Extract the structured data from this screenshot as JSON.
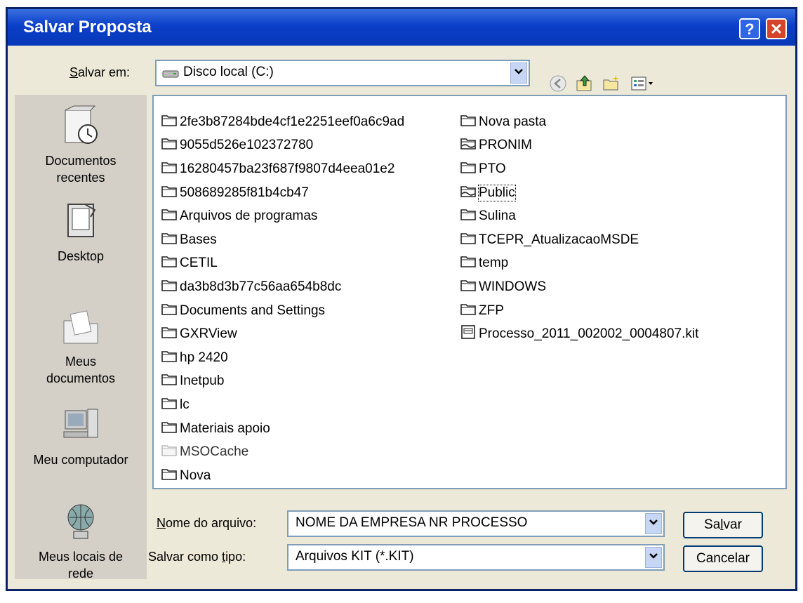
{
  "window": {
    "title": "Salvar Proposta",
    "help_glyph": "?",
    "close_glyph": "✕"
  },
  "location": {
    "label_prefix": "S",
    "label_rest": "alvar em:",
    "value": "Disco local (C:)"
  },
  "places": [
    {
      "name": "recent",
      "line1": "Documentos",
      "line2": "recentes",
      "icon": "recent-documents-icon"
    },
    {
      "name": "desktop",
      "line1": "Desktop",
      "line2": "",
      "icon": "desktop-icon"
    },
    {
      "name": "mydocs",
      "line1": "Meus",
      "line2": "documentos",
      "icon": "my-documents-icon"
    },
    {
      "name": "mycomputer",
      "line1": "Meu computador",
      "line2": "",
      "icon": "my-computer-icon"
    },
    {
      "name": "network",
      "line1": "Meus locais de",
      "line2": "rede",
      "icon": "network-places-icon"
    }
  ],
  "files": {
    "col1": [
      {
        "name": "2fe3b87284bde4cf1e2251eef0a6c9ad",
        "type": "folder"
      },
      {
        "name": "9055d526e102372780",
        "type": "folder"
      },
      {
        "name": "16280457ba23f687f9807d4eea01e2",
        "type": "folder"
      },
      {
        "name": "508689285f81b4cb47",
        "type": "folder"
      },
      {
        "name": "Arquivos de programas",
        "type": "folder"
      },
      {
        "name": "Bases",
        "type": "folder"
      },
      {
        "name": "CETIL",
        "type": "folder"
      },
      {
        "name": "da3b8d3b77c56aa654b8dc",
        "type": "folder"
      },
      {
        "name": "Documents and Settings",
        "type": "folder"
      },
      {
        "name": "GXRView",
        "type": "folder"
      },
      {
        "name": "hp 2420",
        "type": "folder"
      },
      {
        "name": "Inetpub",
        "type": "folder"
      },
      {
        "name": "lc",
        "type": "folder"
      },
      {
        "name": "Materiais apoio",
        "type": "folder"
      },
      {
        "name": "MSOCache",
        "type": "folder-hidden"
      },
      {
        "name": "Nova",
        "type": "folder"
      }
    ],
    "col2": [
      {
        "name": "Nova pasta",
        "type": "folder"
      },
      {
        "name": "PRONIM",
        "type": "folder-shared"
      },
      {
        "name": "PTO",
        "type": "folder"
      },
      {
        "name": "Public",
        "type": "folder-shared",
        "selected": true
      },
      {
        "name": "Sulina",
        "type": "folder"
      },
      {
        "name": "TCEPR_AtualizacaoMSDE",
        "type": "folder"
      },
      {
        "name": "temp",
        "type": "folder"
      },
      {
        "name": "WINDOWS",
        "type": "folder"
      },
      {
        "name": "ZFP",
        "type": "folder"
      },
      {
        "name": "Processo_2011_002002_0004807.kit",
        "type": "kit-file"
      }
    ]
  },
  "filename": {
    "label_prefix": "N",
    "label_rest": "ome do arquivo:",
    "value": "NOME DA EMPRESA NR PROCESSO"
  },
  "filetype": {
    "label_pre": "Salvar como ",
    "label_u": "t",
    "label_post": "ipo:",
    "value": "Arquivos KIT (*.KIT)"
  },
  "buttons": {
    "save_pre": "Sa",
    "save_u": "l",
    "save_post": "var",
    "cancel": "Cancelar"
  }
}
